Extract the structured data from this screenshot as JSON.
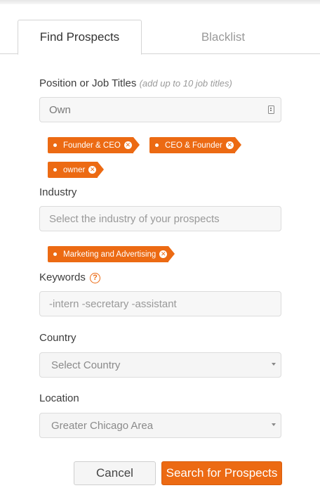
{
  "tabs": [
    {
      "label": "Find Prospects",
      "active": true
    },
    {
      "label": "Blacklist",
      "active": false
    }
  ],
  "job_titles": {
    "label": "Position or Job Titles",
    "hint": "(add up to 10 job titles)",
    "value": "Own",
    "icon": "contact-card-icon",
    "tags": [
      "Founder & CEO",
      "CEO & Founder",
      "owner"
    ]
  },
  "industry": {
    "label": "Industry",
    "placeholder": "Select the industry of your prospects",
    "tags": [
      "Marketing and Advertising"
    ]
  },
  "keywords": {
    "label": "Keywords",
    "help_glyph": "?",
    "placeholder": "-intern -secretary -assistant"
  },
  "country": {
    "label": "Country",
    "value": "Select Country"
  },
  "location": {
    "label": "Location",
    "value": "Greater Chicago Area"
  },
  "actions": {
    "cancel_label": "Cancel",
    "search_label": "Search for Prospects"
  },
  "colors": {
    "accent": "#ec6a13",
    "field_bg": "#f7f7f7",
    "border": "#dcdcdc"
  }
}
